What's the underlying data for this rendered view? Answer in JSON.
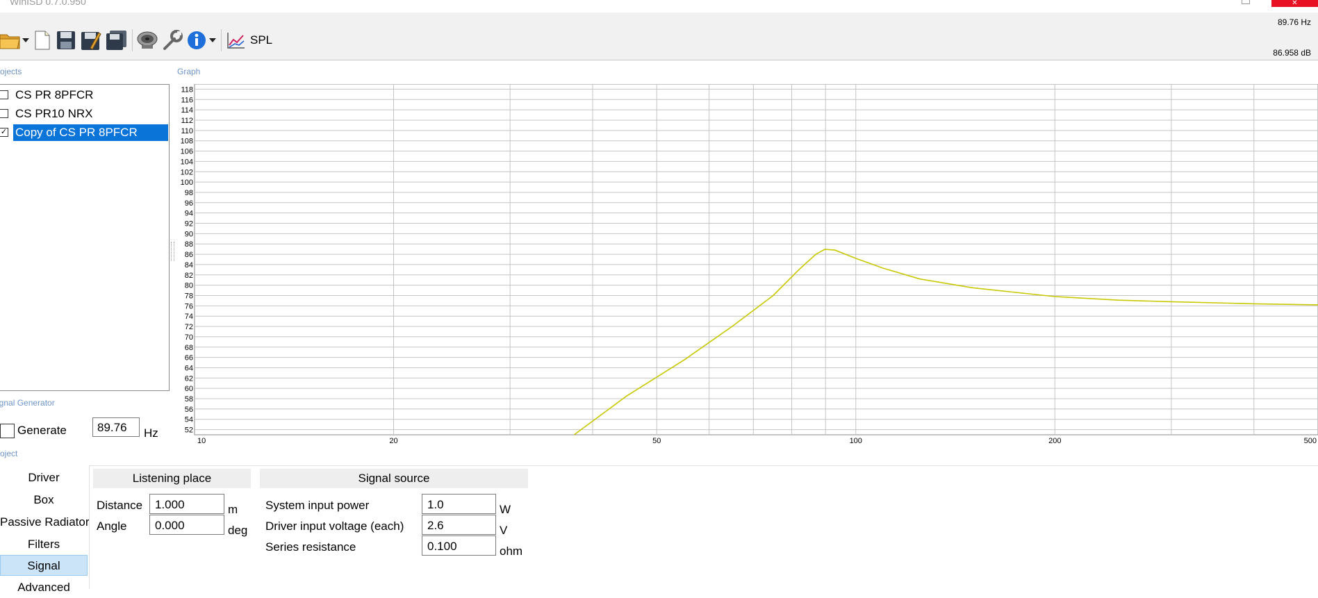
{
  "window": {
    "title": "WinISD 0.7.0.950"
  },
  "toolbar": {
    "icons": [
      "open-folder-icon",
      "new-document-icon",
      "save-icon",
      "save-as-icon",
      "save-all-icon",
      "driver-speaker-icon",
      "tools-wrench-icon",
      "info-icon",
      "spl-graph-icon"
    ],
    "graph_selector_label": "SPL"
  },
  "readouts": {
    "frequency": "89.76 Hz",
    "level": "86.958 dB"
  },
  "projects": {
    "label": "Projects",
    "items": [
      {
        "label": "CS PR 8PFCR",
        "checked": false,
        "selected": false
      },
      {
        "label": "CS PR10 NRX",
        "checked": false,
        "selected": false
      },
      {
        "label": "Copy of CS PR 8PFCR",
        "checked": true,
        "selected": true
      }
    ]
  },
  "signal_generator": {
    "label": "Signal Generator",
    "checkbox_label": "Generate",
    "frequency_value": "89.76",
    "unit": "Hz"
  },
  "graph": {
    "label": "Graph"
  },
  "chart_data": {
    "type": "line",
    "xscale": "log",
    "xlim": [
      10,
      500
    ],
    "ylim": [
      51,
      119
    ],
    "x_tick_labels": [
      "10",
      "20",
      "50",
      "100",
      "200",
      "500"
    ],
    "y_tick_labels": [
      "52",
      "54",
      "56",
      "58",
      "60",
      "62",
      "64",
      "66",
      "68",
      "70",
      "72",
      "74",
      "76",
      "78",
      "80",
      "82",
      "84",
      "86",
      "88",
      "90",
      "92",
      "94",
      "96",
      "98",
      "100",
      "102",
      "104",
      "106",
      "108",
      "110",
      "112",
      "114",
      "116",
      "118"
    ],
    "grid": true,
    "line_color": "#c8c800",
    "series": [
      {
        "x": [
          37.5,
          45,
          55,
          65,
          75,
          82,
          87,
          89.76,
          93,
          100,
          110,
          125,
          150,
          200,
          250,
          300,
          400,
          500
        ],
        "y": [
          51,
          58.5,
          65.5,
          72,
          78,
          83,
          86,
          86.958,
          86.8,
          85.2,
          83.3,
          81.2,
          79.5,
          77.8,
          77.1,
          76.8,
          76.4,
          76.2
        ]
      }
    ]
  },
  "project_section": {
    "label": "Project"
  },
  "tabs": [
    {
      "label": "Driver",
      "active": false
    },
    {
      "label": "Box",
      "active": false
    },
    {
      "label": "Passive Radiator",
      "active": false
    },
    {
      "label": "Filters",
      "active": false
    },
    {
      "label": "Signal",
      "active": true
    },
    {
      "label": "Advanced",
      "active": false
    }
  ],
  "listening_place": {
    "header": "Listening place",
    "distance": {
      "label": "Distance",
      "value": "1.000",
      "unit": "m"
    },
    "angle": {
      "label": "Angle",
      "value": "0.000",
      "unit": "deg"
    }
  },
  "signal_source": {
    "header": "Signal source",
    "input_power": {
      "label": "System input power",
      "value": "1.0",
      "unit": "W"
    },
    "input_voltage": {
      "label": "Driver input voltage (each)",
      "value": "2.6",
      "unit": "V"
    },
    "series_resistance": {
      "label": "Series resistance",
      "value": "0.100",
      "unit": "ohm"
    }
  }
}
